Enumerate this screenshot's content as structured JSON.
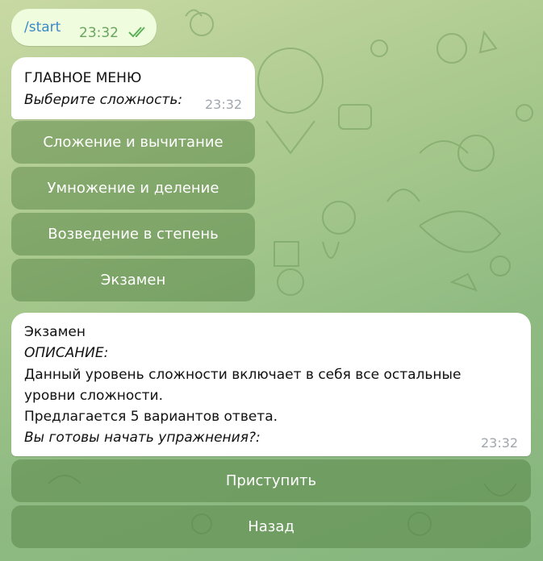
{
  "outgoing": {
    "text": "/start",
    "time": "23:32"
  },
  "main_menu": {
    "title": "ГЛАВНОЕ МЕНЮ",
    "subtitle": "Выберите сложность:",
    "time": "23:32",
    "buttons": [
      "Сложение и вычитание",
      "Умножение и деление",
      "Возведение в степень",
      "Экзамен"
    ]
  },
  "exam_message": {
    "title": "Экзамен",
    "description_label": "ОПИСАНИЕ:",
    "line1": "Данный уровень сложности включает в себя все остальные",
    "line2": "уровни сложности.",
    "line3": "Предлагается 5 вариантов ответа.",
    "question": "Вы готовы начать упражнения?:",
    "time": "23:32",
    "buttons": [
      "Приступить",
      "Назад"
    ]
  },
  "colors": {
    "bg_top": "#c9d9a3",
    "bg_bottom": "#86b67e",
    "outgoing_bubble": "#effdde",
    "outgoing_text": "#3a88c8",
    "outgoing_time": "#68a55e",
    "incoming_bubble": "#ffffff",
    "button_bg": "rgba(74,118,58,0.42)"
  }
}
